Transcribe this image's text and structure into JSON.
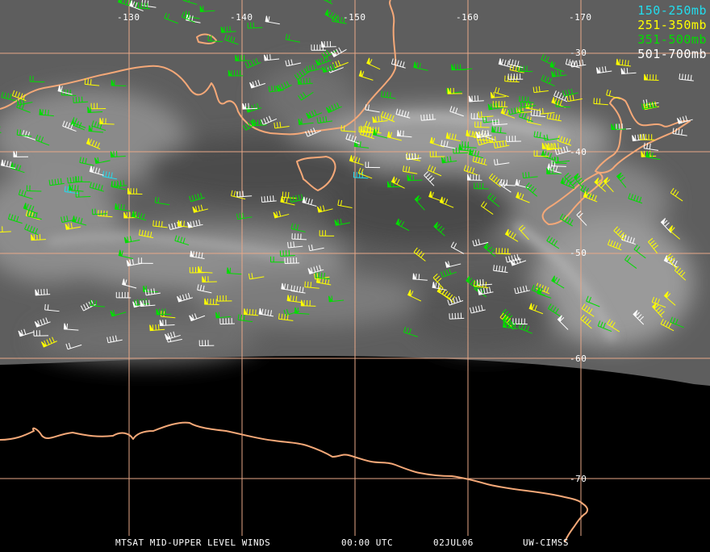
{
  "legend": {
    "items": [
      {
        "label": "150-250mb",
        "color": "#22ddee"
      },
      {
        "label": "251-350mb",
        "color": "#ffff00"
      },
      {
        "label": "351-500mb",
        "color": "#00dd00"
      },
      {
        "label": "501-700mb",
        "color": "#ffffff"
      }
    ]
  },
  "grid": {
    "longitude_labels": [
      "-130",
      "-140",
      "-150",
      "-160",
      "-170"
    ],
    "latitude_labels": [
      "-30",
      "-40",
      "-50",
      "-60",
      "-70"
    ]
  },
  "colors": {
    "coastline": "#f4a878",
    "gridline": "#e8a888",
    "satellite_gray": "#6a6a6a",
    "no_data": "#000000"
  },
  "footer": {
    "product": "MTSAT MID-UPPER LEVEL WINDS",
    "time": "00:00 UTC",
    "date": "02JUL06",
    "source": "UW-CIMSS"
  }
}
